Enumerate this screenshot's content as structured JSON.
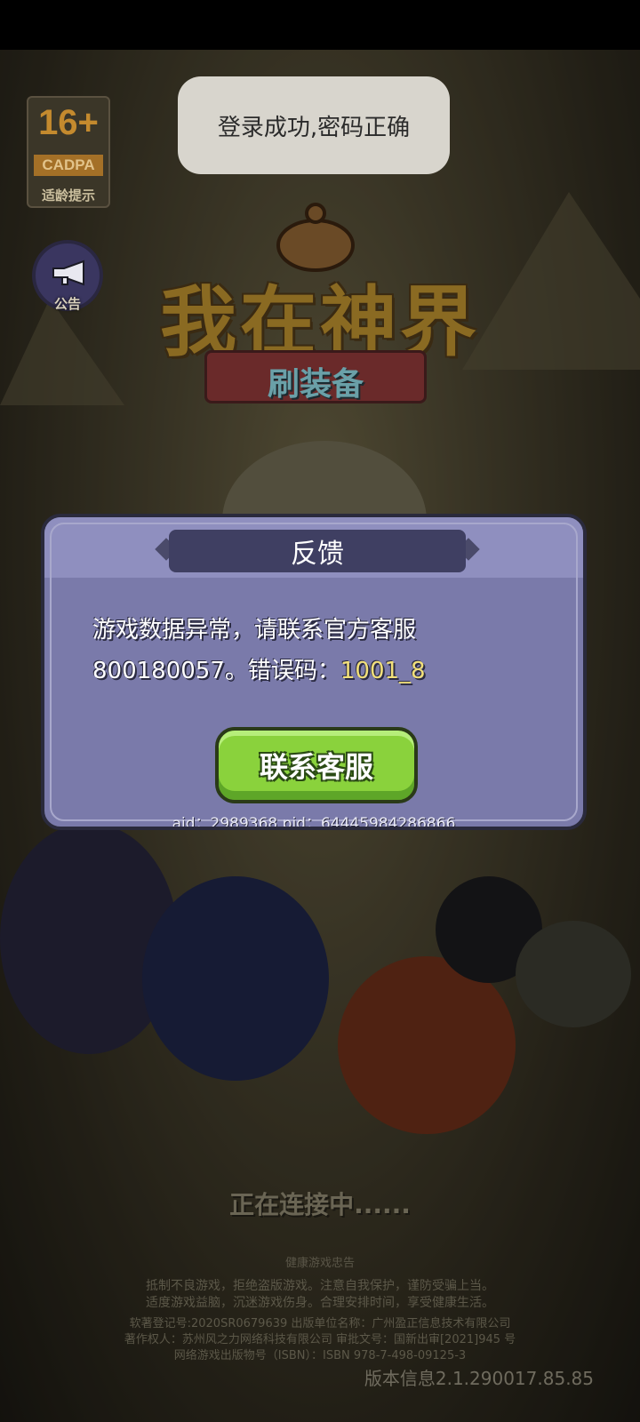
{
  "toast": {
    "text": "登录成功,密码正确"
  },
  "age_badge": {
    "rating": "16+",
    "org": "CADPA",
    "tip": "适龄提示"
  },
  "notice": {
    "label": "公告"
  },
  "logo": {
    "title": "我在神界",
    "subtitle": "刷装备"
  },
  "dialog": {
    "title": "反馈",
    "message_line1": "游戏数据异常，请联系官方客服",
    "message_line2_prefix": "800180057。错误码：",
    "error_code": "1001_8",
    "button_label": "联系客服",
    "ids_text": "aid：2989368  pid：64445984286866"
  },
  "status": {
    "connecting": "正在连接中......"
  },
  "health": {
    "title": "健康游戏忠告",
    "line1": "抵制不良游戏，拒绝盗版游戏。注意自我保护，谨防受骗上当。",
    "line2": "适度游戏益脑，沉迷游戏伤身。合理安排时间，享受健康生活。"
  },
  "legal": {
    "line1": "软著登记号:2020SR0679639 出版单位名称：广州盈正信息技术有限公司",
    "line2": "著作权人：苏州风之力网络科技有限公司 审批文号：国新出审[2021]945 号",
    "line3": "网络游戏出版物号（ISBN）：ISBN 978-7-498-09125-3"
  },
  "version": {
    "text": "版本信息2.1.290017.85.85"
  }
}
